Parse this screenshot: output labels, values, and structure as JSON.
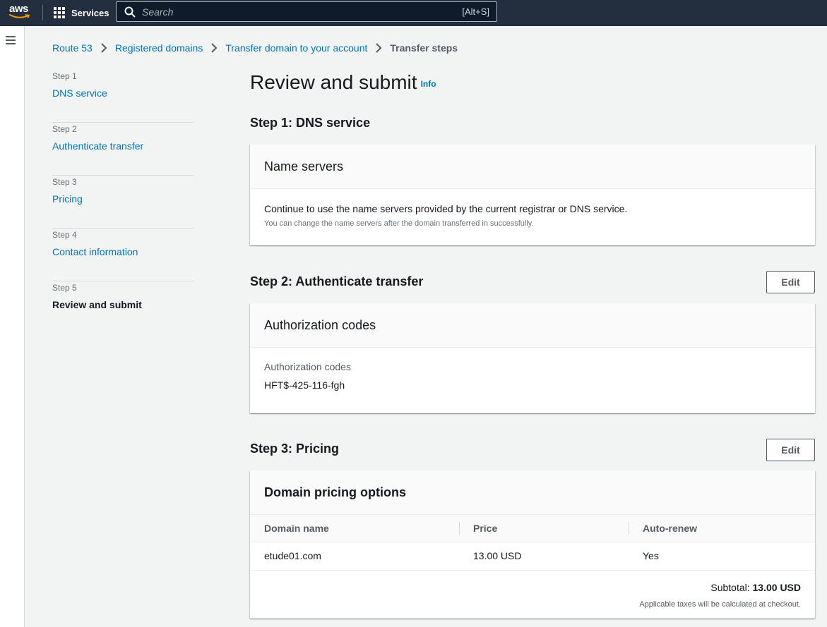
{
  "topbar": {
    "logo_text": "aws",
    "services_label": "Services",
    "search_placeholder": "Search",
    "search_shortcut": "[Alt+S]"
  },
  "breadcrumb": {
    "items": [
      "Route 53",
      "Registered domains",
      "Transfer domain to your account"
    ],
    "current": "Transfer steps"
  },
  "steps": [
    {
      "num": "Step 1",
      "label": "DNS service"
    },
    {
      "num": "Step 2",
      "label": "Authenticate transfer"
    },
    {
      "num": "Step 3",
      "label": "Pricing"
    },
    {
      "num": "Step 4",
      "label": "Contact information"
    },
    {
      "num": "Step 5",
      "label": "Review and submit"
    }
  ],
  "page": {
    "title": "Review and submit",
    "info": "Info"
  },
  "sections": {
    "dns": {
      "heading": "Step 1: DNS service",
      "card_title": "Name servers",
      "text": "Continue to use the name servers provided by the current registrar or DNS service.",
      "subtext": "You can change the name servers after the domain transferred in successfully."
    },
    "auth": {
      "heading": "Step 2: Authenticate transfer",
      "edit_label": "Edit",
      "card_title": "Authorization codes",
      "key": "Authorization codes",
      "value": "HFT$-425-116-fgh"
    },
    "pricing": {
      "heading": "Step 3: Pricing",
      "edit_label": "Edit",
      "card_title": "Domain pricing options",
      "columns": [
        "Domain name",
        "Price",
        "Auto-renew"
      ],
      "rows": [
        [
          "etude01.com",
          "13.00 USD",
          "Yes"
        ]
      ],
      "subtotal_label": "Subtotal:",
      "subtotal_value": "13.00 USD",
      "tax_note": "Applicable taxes will be calculated at checkout."
    }
  },
  "colors": {
    "nav_bg": "#232f3e",
    "link": "#0073bb",
    "page_bg": "#f2f3f3",
    "smile": "#ff9900"
  }
}
